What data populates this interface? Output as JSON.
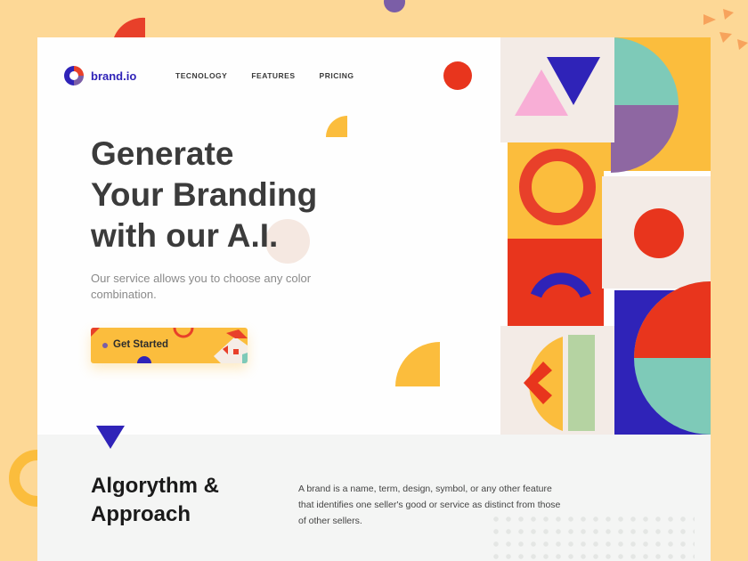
{
  "brand": {
    "name": "brand.io"
  },
  "nav": {
    "items": [
      "TECNOLOGY",
      "FEATURES",
      "PRICING"
    ]
  },
  "hero": {
    "headline": [
      "Generate",
      "Your Branding",
      "with our A.I."
    ],
    "subtext": "Our service allows you to choose any color combination.",
    "cta_label": "Get Started"
  },
  "section": {
    "title": [
      "Algorythm &",
      "Approach"
    ],
    "description": "A brand is a name, term, design, symbol, or any other feature that identifies one seller's good or service as distinct from those of other sellers."
  },
  "colors": {
    "background": "#fdd896",
    "accent_red": "#e8351d",
    "accent_blue": "#2f23b8",
    "accent_yellow": "#fbbd3d",
    "accent_teal": "#7ecab8",
    "accent_purple": "#7b5ea7"
  }
}
